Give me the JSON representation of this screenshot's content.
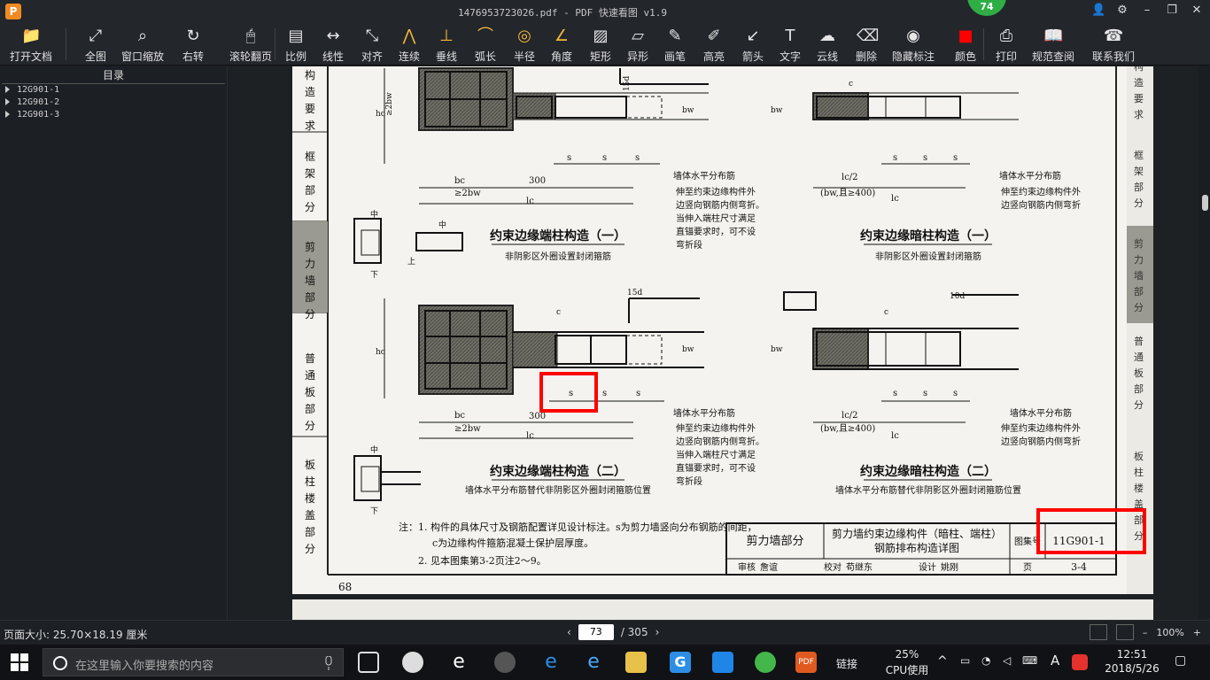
{
  "window": {
    "title": "1476953723026.pdf - PDF 快速看图 v1.9",
    "logo_letter": "P",
    "badge": "74",
    "controls": [
      "👤",
      "⚙",
      "–",
      "❐",
      "✕"
    ]
  },
  "toolbar": {
    "items": [
      {
        "id": "open",
        "label": "打开文档",
        "icon": "folder-icon"
      },
      {
        "id": "fit",
        "label": "全图",
        "icon": "fit-all-icon"
      },
      {
        "id": "zoom-window",
        "label": "窗口缩放",
        "icon": "magnifier-icon"
      },
      {
        "id": "rotate",
        "label": "右转",
        "icon": "rotate-right-icon"
      },
      {
        "id": "scroll",
        "label": "滚轮翻页",
        "icon": "mouse-icon"
      },
      {
        "id": "scale",
        "label": "比例",
        "icon": "ruler-icon"
      },
      {
        "id": "linear",
        "label": "线性",
        "icon": "linear-dimension-icon"
      },
      {
        "id": "aligned",
        "label": "对齐",
        "icon": "aligned-dimension-icon"
      },
      {
        "id": "continuous",
        "label": "连续",
        "icon": "continuous-dimension-icon"
      },
      {
        "id": "perpendicular",
        "label": "垂线",
        "icon": "perpendicular-icon"
      },
      {
        "id": "arc",
        "label": "弧长",
        "icon": "arc-length-icon"
      },
      {
        "id": "radius",
        "label": "半径",
        "icon": "radius-icon"
      },
      {
        "id": "angle",
        "label": "角度",
        "icon": "angle-icon"
      },
      {
        "id": "rect",
        "label": "矩形",
        "icon": "rectangle-icon"
      },
      {
        "id": "irregular",
        "label": "异形",
        "icon": "irregular-shape-icon"
      },
      {
        "id": "pen",
        "label": "画笔",
        "icon": "pen-icon"
      },
      {
        "id": "highlight",
        "label": "高亮",
        "icon": "highlighter-icon"
      },
      {
        "id": "arrow",
        "label": "箭头",
        "icon": "arrow-icon"
      },
      {
        "id": "text",
        "label": "文字",
        "icon": "text-icon"
      },
      {
        "id": "cloud",
        "label": "云线",
        "icon": "cloud-line-icon"
      },
      {
        "id": "delete",
        "label": "删除",
        "icon": "eraser-icon"
      },
      {
        "id": "hide",
        "label": "隐藏标注",
        "icon": "eye-hidden-icon"
      },
      {
        "id": "color",
        "label": "颜色",
        "icon": "color-swatch-icon"
      },
      {
        "id": "print",
        "label": "打印",
        "icon": "printer-icon"
      },
      {
        "id": "spec",
        "label": "规范查阅",
        "icon": "book-icon"
      },
      {
        "id": "contact",
        "label": "联系我们",
        "icon": "support-icon"
      }
    ],
    "color_swatch": "#ff0000"
  },
  "sidebar": {
    "title": "目录",
    "items": [
      "12G901-1",
      "12G901-2",
      "12G901-3"
    ]
  },
  "drawing": {
    "tabs": [
      "构造要求",
      "框架部分",
      "剪力墙部分",
      "普通板部分",
      "板柱楼盖部分"
    ],
    "right_tabs": [
      "构造要求",
      "框架部分",
      "剪力墙部分",
      "普通板部分",
      "板柱楼盖部分"
    ],
    "titles": {
      "t1": "约束边缘端柱构造（一）",
      "t1s": "非阴影区外圈设置封闭箍筋",
      "t2": "约束边缘暗柱构造（一）",
      "t2s": "非阴影区外圈设置封闭箍筋",
      "t3": "约束边缘端柱构造（二）",
      "t3s": "墙体水平分布筋替代非阴影区外圈封闭箍筋位置",
      "t4": "约束边缘暗柱构造（二）",
      "t4s": "墙体水平分布筋替代非阴影区外圈封闭箍筋位置"
    },
    "dims": {
      "s": "s",
      "c": "c",
      "d15": "15d",
      "d10": "10d",
      "d300": "300",
      "bc": "bc",
      "bw2": "≥2bw",
      "lc": "lc",
      "lc2": "lc/2",
      "bw400": "(bw,且≥400)",
      "hc": "hc",
      "bw": "bw",
      "zhong": "中",
      "shang": "上",
      "xia": "下"
    },
    "notes": {
      "n_dist": "墙体水平分布筋",
      "n_ext": [
        "伸至约束边缘构件外",
        "边竖向钢筋内侧弯折。",
        "当伸入端柱尺寸满足",
        "直锚要求时，可不设",
        "弯折段"
      ],
      "n_ext2": [
        "伸至约束边缘构件外",
        "边竖向钢筋内侧弯折"
      ],
      "foot1": "注：1. 构件的具体尺寸及钢筋配置详见设计标注。s为剪力墙竖向分布钢筋的间距，",
      "foot1b": "c为边缘构件箍筋混凝土保护层厚度。",
      "foot2": "2. 见本图集第3-2页注2～9。"
    },
    "titleblock": {
      "section": "剪力墙部分",
      "name1": "剪力墙约束边缘构件（暗柱、端柱）",
      "name2": "钢筋排布构造详图",
      "atlas_label": "图集号",
      "atlas_no": "11G901-1",
      "review": "审核",
      "reviewer": "詹谊",
      "check": "校对",
      "checker": "苟继东",
      "design": "设计",
      "designer": "姚刚",
      "page_label": "页",
      "page_no": "3-4"
    },
    "page_num": "68",
    "highlight_color": "#ff0000"
  },
  "statusbar": {
    "page_size": "页面大小: 25.70×18.19 厘米",
    "current_page": "73",
    "total": "/ 305",
    "zoom": "100%"
  },
  "taskbar": {
    "search_placeholder": "在这里输入你要搜索的内容",
    "cpu_percent": "25%",
    "cpu_label": "CPU使用",
    "link_label": "链接",
    "time": "12:51",
    "date": "2018/5/26",
    "ime": "A"
  }
}
